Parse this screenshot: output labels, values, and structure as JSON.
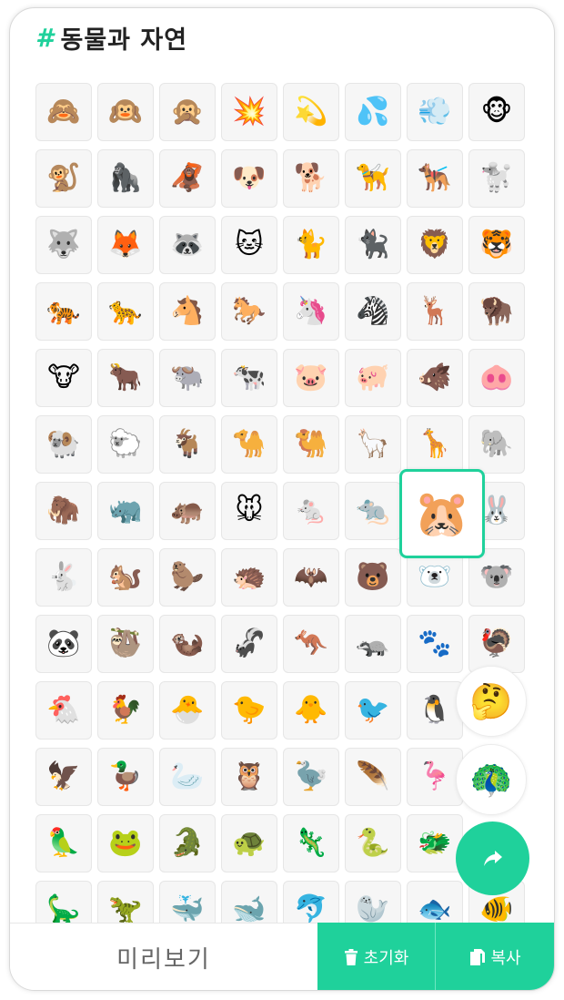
{
  "header": {
    "hash": "#",
    "title": "동물과 자연"
  },
  "rows": [
    [
      "🙈",
      "🙉",
      "🙊",
      "💥",
      "💫",
      "💦",
      "💨",
      "🐵"
    ],
    [
      "🐒",
      "🦍",
      "🦧",
      "🐶",
      "🐕",
      "🦮",
      "🐕‍🦺",
      "🐩"
    ],
    [
      "🐺",
      "🦊",
      "🦝",
      "🐱",
      "🐈",
      "🐈‍⬛",
      "🦁",
      "🐯"
    ],
    [
      "🐅",
      "🐆",
      "🐴",
      "🐎",
      "🦄",
      "🦓",
      "🦌",
      "🦬"
    ],
    [
      "🐮",
      "🐂",
      "🐃",
      "🐄",
      "🐷",
      "🐖",
      "🐗",
      "🐽"
    ],
    [
      "🐏",
      "🐑",
      "🐐",
      "🐪",
      "🐫",
      "🦙",
      "🦒",
      "🐘"
    ],
    [
      "🦣",
      "🦏",
      "🦛",
      "🐭",
      "🐁",
      "🐀",
      "🐹",
      "🐰"
    ],
    [
      "🐇",
      "🐿️",
      "🦫",
      "🦔",
      "🦇",
      "🐻",
      "🐻‍❄️",
      "🐨"
    ],
    [
      "🐼",
      "🦥",
      "🦦",
      "🦨",
      "🦘",
      "🦡",
      "🐾",
      "🦃"
    ],
    [
      "🐔",
      "🐓",
      "🐣",
      "🐤",
      "🐥",
      "🐦",
      "🐧",
      ""
    ],
    [
      "🦅",
      "🦆",
      "🦢",
      "🦉",
      "🦤",
      "🪶",
      "🦩",
      ""
    ],
    [
      "🦜",
      "🐸",
      "🐊",
      "🐢",
      "🦎",
      "🐍",
      "🐲",
      ""
    ],
    [
      "🦕",
      "🦖",
      "🐳",
      "🐋",
      "🐬",
      "🦭",
      "🐟",
      "🐠"
    ]
  ],
  "selected": {
    "row": 6,
    "col": 6
  },
  "floating": {
    "thinking": "🤔",
    "peacock": "🦚"
  },
  "bottom": {
    "preview": "미리보기",
    "reset": "초기화",
    "copy": "복사"
  },
  "colors": {
    "accent": "#1fd19b"
  },
  "icons": {
    "share": "share-arrow-icon",
    "reset": "trash-icon",
    "copy": "copy-icon"
  }
}
